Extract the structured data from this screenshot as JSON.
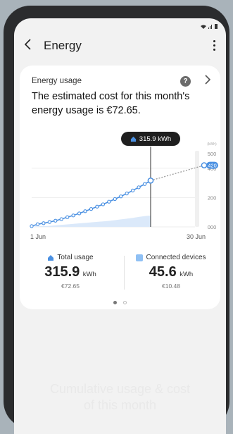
{
  "status_bar": {
    "icons": [
      "wifi-icon",
      "signal-icon",
      "battery-icon"
    ]
  },
  "appbar": {
    "back_icon": "chevron-left-icon",
    "title": "Energy",
    "menu_icon": "more-vertical-icon"
  },
  "card": {
    "label": "Energy usage",
    "help_icon": "question-icon",
    "chevron_icon": "chevron-right-icon",
    "headline": "The estimated cost for this month's energy usage is €72.65.",
    "tooltip": "315.9 kWh",
    "total_usage": {
      "label": "Total usage",
      "value": "315.9",
      "unit": "kWh",
      "cost": "€72.65"
    },
    "connected_devices": {
      "label": "Connected devices",
      "value": "45.6",
      "unit": "kWh",
      "cost": "€10.48"
    },
    "pagination": {
      "count": 2,
      "active": 0
    }
  },
  "chart_data": {
    "type": "line",
    "x_start_label": "1 Jun",
    "x_end_label": "30 Jun",
    "unit_label": "(kWh)",
    "y_ticks": [
      "500",
      "400",
      "200",
      "000"
    ],
    "ylim": [
      0,
      500
    ],
    "current_day": 21,
    "current_value": 315.9,
    "projected_end_value": 420,
    "projected_label": "420",
    "series": [
      {
        "name": "Total usage",
        "x": [
          1,
          2,
          3,
          4,
          5,
          6,
          7,
          8,
          9,
          10,
          11,
          12,
          13,
          14,
          15,
          16,
          17,
          18,
          19,
          20,
          21
        ],
        "values": [
          5,
          18,
          25,
          33,
          42,
          53,
          66,
          78,
          92,
          107,
          122,
          138,
          154,
          172,
          190,
          208,
          228,
          248,
          270,
          292,
          315.9
        ]
      }
    ],
    "connected_devices_area": [
      1,
      2,
      3,
      4,
      6,
      8,
      10,
      12,
      14,
      16,
      18,
      20,
      22,
      24,
      27,
      30,
      33,
      36,
      40,
      43,
      45.6
    ]
  },
  "caption": {
    "line1": "Cumulative usage & cost",
    "line2": "of this month"
  },
  "colors": {
    "accent": "#4a90e2",
    "area": "#dbe9fa",
    "dotted": "#9a9a9a"
  }
}
